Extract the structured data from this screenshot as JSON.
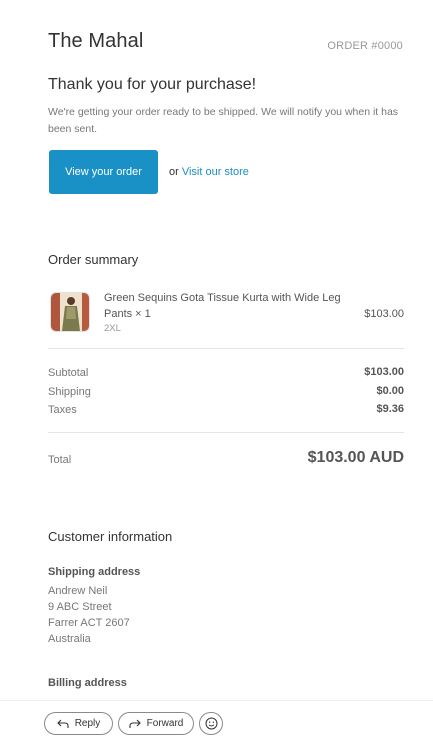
{
  "email": {
    "shop_name": "The Mahal",
    "order_number": "ORDER #0000",
    "thanks_title": "Thank you for your purchase!",
    "thanks_text": "We're getting your order ready to be shipped. We will notify you when it has been sent.",
    "cta_label": "View your order",
    "or_text": "or",
    "store_link": "Visit our store"
  },
  "order_summary": {
    "title": "Order summary",
    "items": [
      {
        "title": "Green Sequins Gota Tissue Kurta with Wide Leg Pants × 1",
        "variant": "2XL",
        "price": "$103.00"
      }
    ],
    "subtotal_label": "Subtotal",
    "subtotal_value": "$103.00",
    "shipping_label": "Shipping",
    "shipping_value": "$0.00",
    "taxes_label": "Taxes",
    "taxes_value": "$9.36",
    "total_label": "Total",
    "total_value": "$103.00 AUD"
  },
  "customer_info": {
    "title": "Customer information",
    "shipping_heading": "Shipping address",
    "shipping_lines": [
      "Andrew Neil",
      "9 ABC Street",
      "Farrer ACT 2607",
      "Australia"
    ],
    "billing_heading": "Billing address"
  },
  "footer": {
    "reply_label": "Reply",
    "forward_label": "Forward"
  },
  "icons": {
    "reply": "reply-arrow-icon",
    "forward": "forward-arrow-icon",
    "emoji": "smiley-face-icon"
  },
  "colors": {
    "accent": "#1990c6"
  }
}
